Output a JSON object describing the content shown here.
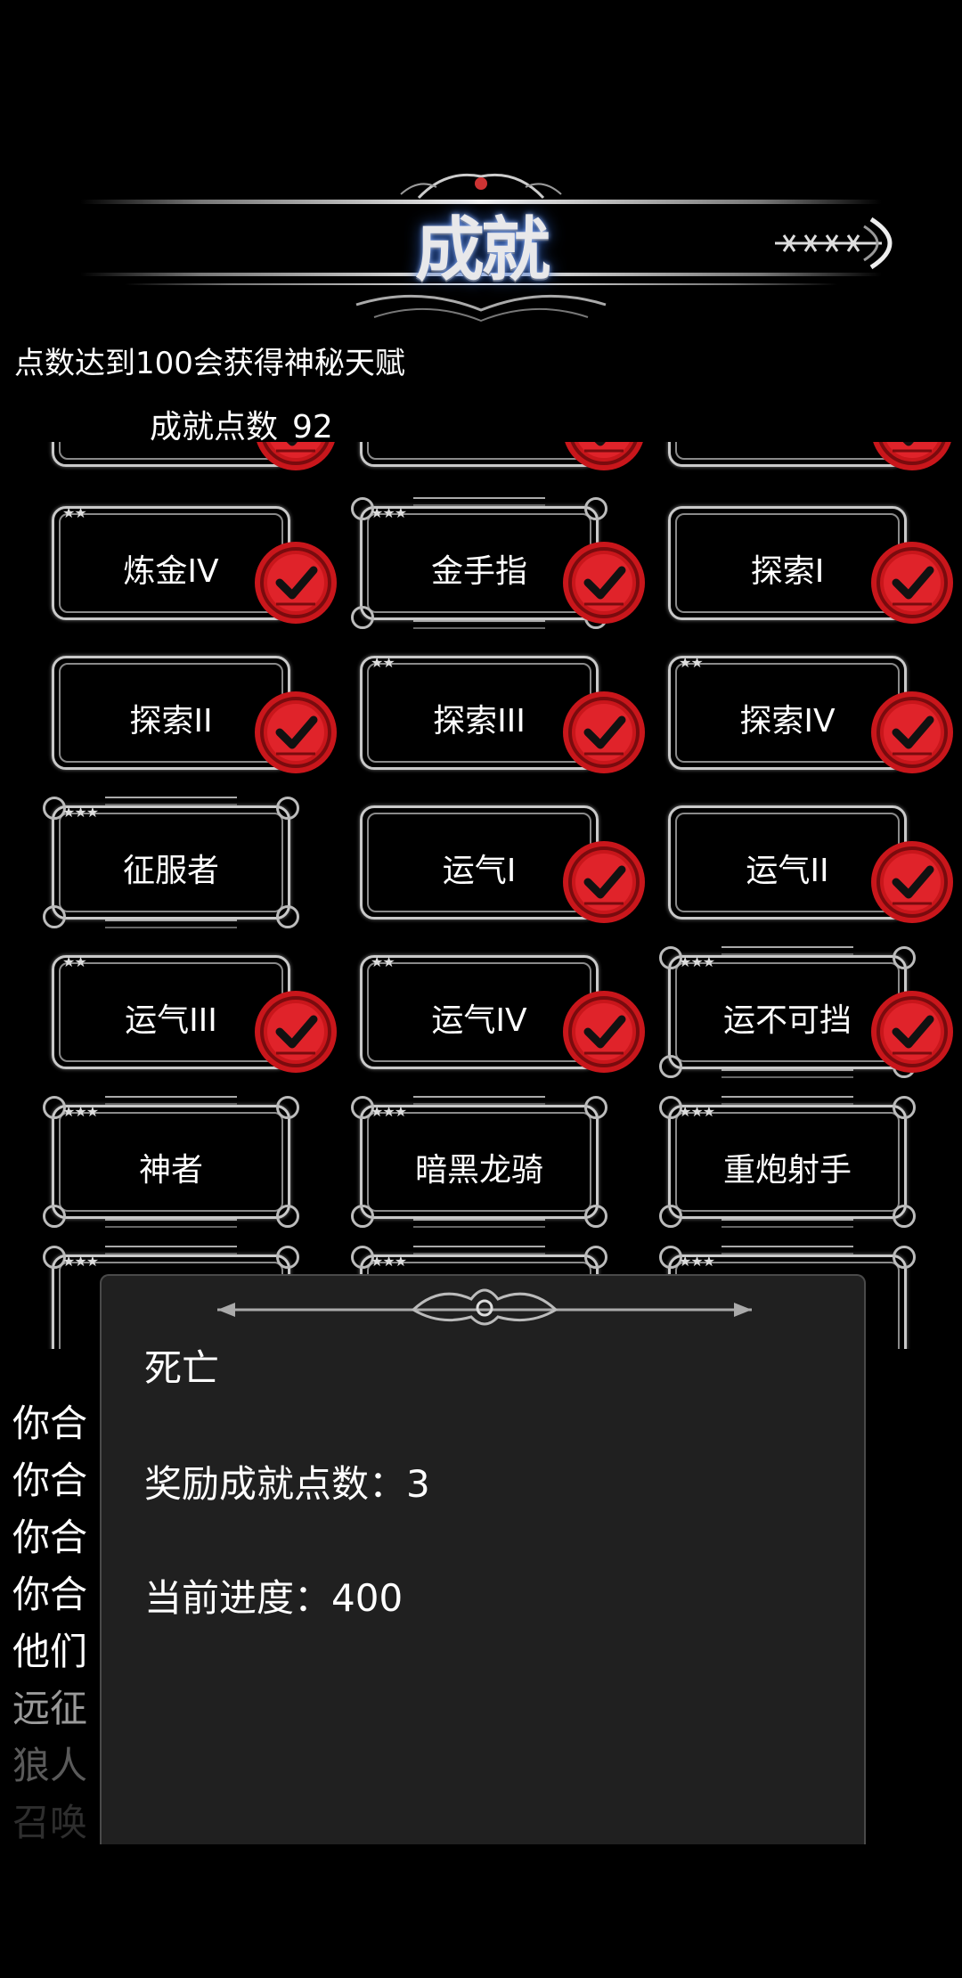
{
  "header": {
    "title": "成就",
    "back_icon": "arrow-right-icon"
  },
  "hint_text": "点数达到100会获得神秘天赋",
  "points": {
    "label": "成就点数",
    "value": "92"
  },
  "achievements": [
    {
      "name": "",
      "stars": 0,
      "completed": true,
      "ornate": false
    },
    {
      "name": "",
      "stars": 0,
      "completed": true,
      "ornate": false
    },
    {
      "name": "",
      "stars": 0,
      "completed": true,
      "ornate": false
    },
    {
      "name": "炼金IV",
      "stars": 2,
      "completed": true,
      "ornate": false
    },
    {
      "name": "金手指",
      "stars": 3,
      "completed": true,
      "ornate": true
    },
    {
      "name": "探索I",
      "stars": 0,
      "completed": true,
      "ornate": false
    },
    {
      "name": "探索II",
      "stars": 0,
      "completed": true,
      "ornate": false
    },
    {
      "name": "探索III",
      "stars": 2,
      "completed": true,
      "ornate": false
    },
    {
      "name": "探索IV",
      "stars": 2,
      "completed": true,
      "ornate": false
    },
    {
      "name": "征服者",
      "stars": 3,
      "completed": false,
      "ornate": true
    },
    {
      "name": "运气I",
      "stars": 0,
      "completed": true,
      "ornate": false
    },
    {
      "name": "运气II",
      "stars": 0,
      "completed": true,
      "ornate": false
    },
    {
      "name": "运气III",
      "stars": 2,
      "completed": true,
      "ornate": false
    },
    {
      "name": "运气IV",
      "stars": 2,
      "completed": true,
      "ornate": false
    },
    {
      "name": "运不可挡",
      "stars": 3,
      "completed": true,
      "ornate": true
    },
    {
      "name": "神者",
      "stars": 3,
      "completed": false,
      "ornate": true
    },
    {
      "name": "暗黑龙骑",
      "stars": 3,
      "completed": false,
      "ornate": true
    },
    {
      "name": "重炮射手",
      "stars": 3,
      "completed": false,
      "ornate": true
    },
    {
      "name": "",
      "stars": 3,
      "completed": false,
      "ornate": true
    },
    {
      "name": "",
      "stars": 3,
      "completed": false,
      "ornate": true
    },
    {
      "name": "",
      "stars": 3,
      "completed": false,
      "ornate": true
    }
  ],
  "background_log": [
    {
      "text": "你合",
      "color": "#ffffff"
    },
    {
      "text": "你合",
      "color": "#ffffff"
    },
    {
      "text": "你合",
      "color": "#ffffff"
    },
    {
      "text": "你合",
      "color": "#ffffff"
    },
    {
      "text": "他们",
      "color": "#ffffff"
    },
    {
      "text": "远征",
      "color": "#9a9a9a"
    },
    {
      "text": "狼人",
      "color": "#5a5a5a"
    },
    {
      "text": "召唤",
      "color": "#2e2e2e"
    }
  ],
  "dialog": {
    "title": "死亡",
    "reward_line": "奖励成就点数：3",
    "progress_line": "当前进度：400"
  }
}
